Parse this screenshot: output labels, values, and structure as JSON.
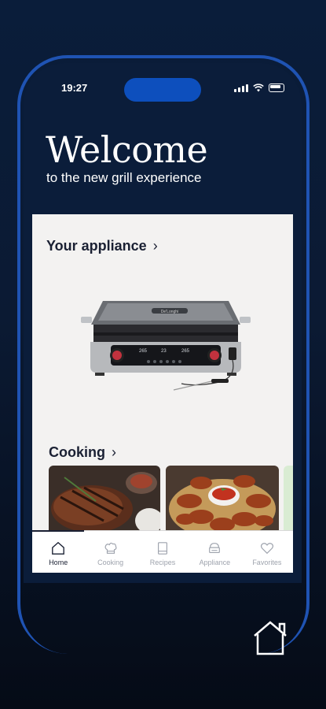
{
  "status": {
    "time": "19:27"
  },
  "hero": {
    "title": "Welcome",
    "subtitle": "to the new grill experience"
  },
  "sections": {
    "appliance": {
      "label": "Your appliance"
    },
    "cooking": {
      "label": "Cooking"
    }
  },
  "appliance_display": {
    "brand": "De'Longhi",
    "left_temp": "265",
    "center": "23",
    "right_temp": "265"
  },
  "tabs": [
    {
      "label": "Home",
      "icon": "home-icon",
      "active": true
    },
    {
      "label": "Cooking",
      "icon": "chef-hat-icon",
      "active": false
    },
    {
      "label": "Recipes",
      "icon": "book-icon",
      "active": false
    },
    {
      "label": "Appliance",
      "icon": "grill-icon",
      "active": false
    },
    {
      "label": "Favorites",
      "icon": "heart-icon",
      "active": false
    }
  ],
  "colors": {
    "accent": "#1f53b3",
    "dark": "#0b1d3a",
    "text": "#1a2033"
  }
}
